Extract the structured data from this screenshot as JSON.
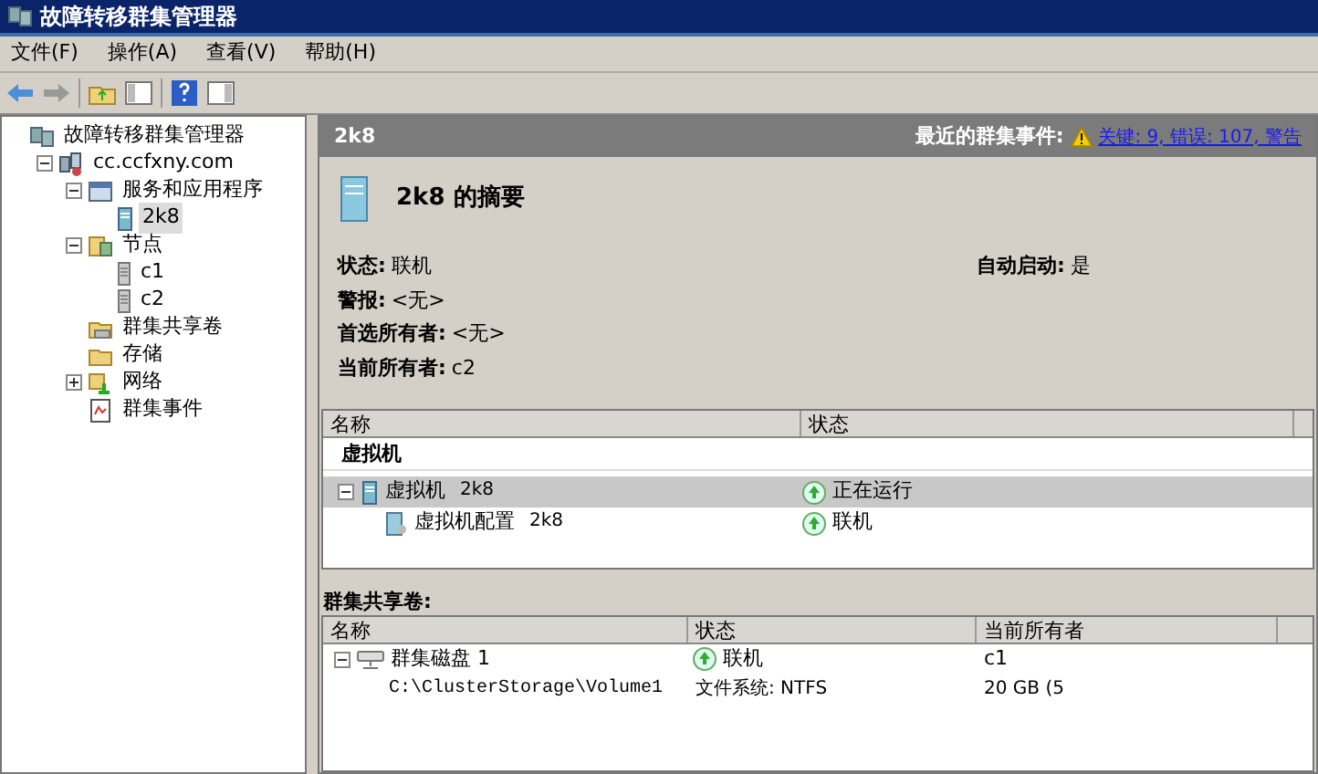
{
  "window": {
    "title": "故障转移群集管理器"
  },
  "menu": [
    "文件(F)",
    "操作(A)",
    "查看(V)",
    "帮助(H)"
  ],
  "tree": [
    {
      "label": "故障转移群集管理器",
      "kind": "manager",
      "selected": false,
      "children": [
        {
          "label": "cc.ccfxny.com",
          "kind": "cluster",
          "selected": false,
          "expanded": true,
          "children": [
            {
              "label": "服务和应用程序",
              "kind": "services",
              "selected": false,
              "expanded": true,
              "children": [
                {
                  "label": "2k8",
                  "kind": "vm",
                  "selected": true
                }
              ]
            },
            {
              "label": "节点",
              "kind": "nodes",
              "selected": false,
              "expanded": true,
              "children": [
                {
                  "label": "c1",
                  "kind": "server",
                  "selected": false
                },
                {
                  "label": "c2",
                  "kind": "server",
                  "selected": false
                }
              ]
            },
            {
              "label": "群集共享卷",
              "kind": "volumes",
              "selected": false
            },
            {
              "label": "存储",
              "kind": "storage",
              "selected": false
            },
            {
              "label": "网络",
              "kind": "network",
              "selected": false,
              "expanded": false
            },
            {
              "label": "群集事件",
              "kind": "events",
              "selected": false
            }
          ]
        }
      ]
    }
  ],
  "header": {
    "title": "2k8",
    "events_label": "最近的群集事件:",
    "events_link": "关键: 9, 错误: 107, 警告"
  },
  "summary": {
    "title": "2k8 的摘要",
    "fields": [
      {
        "label": "状态:",
        "value": "联机"
      },
      {
        "label": "警报:",
        "value": "<无>"
      },
      {
        "label": "首选所有者:",
        "value": "<无>"
      },
      {
        "label": "当前所有者:",
        "value": "c2"
      }
    ],
    "side_fields": [
      {
        "label": "自动启动:",
        "value": "是"
      }
    ]
  },
  "resources": {
    "columns": [
      "名称",
      "状态"
    ],
    "group": "虚拟机",
    "rows": [
      {
        "name": "虚拟机",
        "suffix": "2k8",
        "status": "正在运行",
        "kind": "vm",
        "selected": true,
        "expanded": true,
        "children": [
          {
            "name": "虚拟机配置",
            "suffix": "2k8",
            "status": "联机",
            "kind": "config",
            "selected": false
          }
        ]
      }
    ]
  },
  "volumes": {
    "title": "群集共享卷:",
    "columns": [
      "名称",
      "状态",
      "当前所有者"
    ],
    "rows": [
      {
        "name": "群集磁盘 1",
        "status": "联机",
        "owner": "c1",
        "expanded": true,
        "path": "C:\\ClusterStorage\\Volume1",
        "filesystem": "文件系统: NTFS",
        "size": "20 GB (5"
      }
    ]
  }
}
